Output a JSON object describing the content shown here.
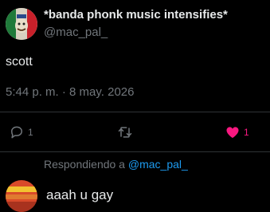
{
  "tweet": {
    "author_name": "*banda phonk music intensifies*",
    "author_handle": "@mac_pal_",
    "text": "scott",
    "timestamp": "5:44 p. m. · 8 may. 2026"
  },
  "actions": {
    "reply_count": "1",
    "like_count": "1",
    "liked": true
  },
  "reply": {
    "replying_to_prefix": "Respondiendo a",
    "replying_to_handle": "@mac_pal_",
    "text": "aaah u gay"
  },
  "icons": {
    "reply": "reply-icon",
    "retweet": "retweet-icon",
    "like": "heart-icon"
  },
  "colors": {
    "background": "#000000",
    "text": "#e7e9ea",
    "secondary": "#71767b",
    "like": "#f91880",
    "link": "#1d9bf0"
  }
}
